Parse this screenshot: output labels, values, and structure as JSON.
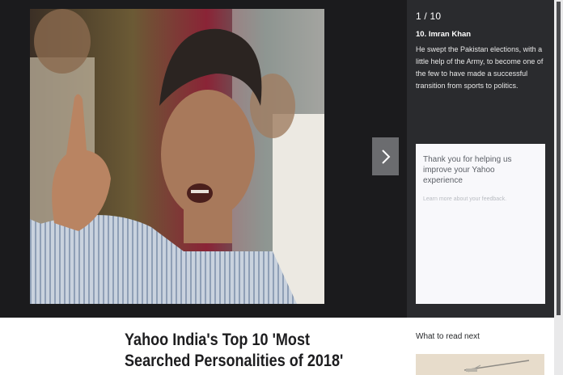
{
  "slideshow": {
    "counter": "1 / 10",
    "title": "10. Imran Khan",
    "description": "He swept the Pakistan elections, with a little help of the Army, to become one of the few to have made a successful transition from sports to politics.",
    "next_icon": "chevron-right-icon",
    "photo_subject": "man pointing finger and speaking"
  },
  "feedback": {
    "message": "Thank you for helping us improve your Yahoo experience",
    "link": "Learn more about your feedback."
  },
  "article": {
    "headline": "Yahoo India's Top 10 'Most Searched Personalities of 2018'"
  },
  "sidebar": {
    "heading": "What to read next"
  },
  "colors": {
    "viewer_bg": "#1b1b1d",
    "panel_bg": "#2a2b2e",
    "next_button_bg": "#6b6c6f",
    "feedback_bg": "#f8f8fb"
  }
}
